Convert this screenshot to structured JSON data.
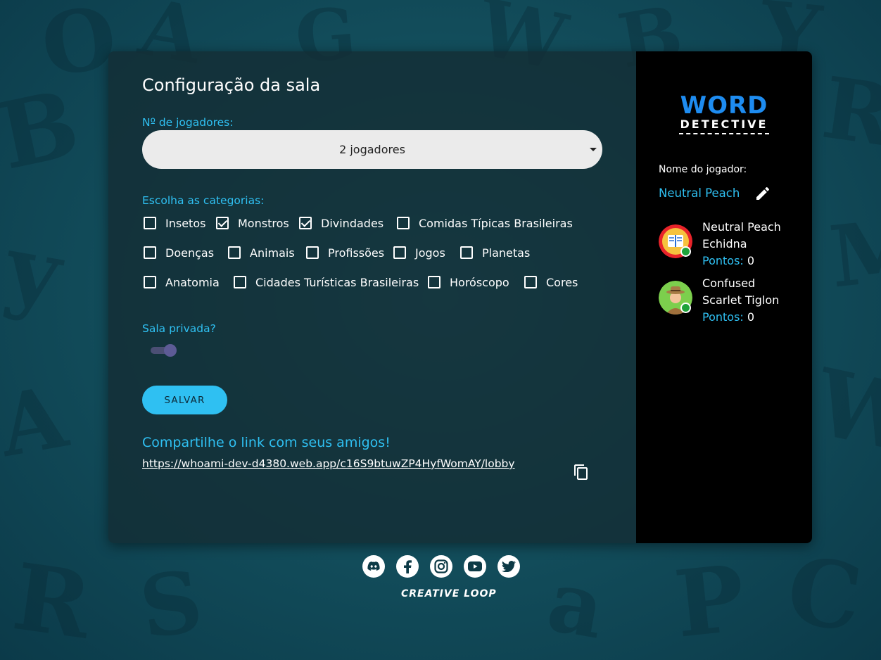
{
  "room": {
    "title": "Configuração da sala",
    "players_label": "Nº de jogadores:",
    "players_selected": "2 jogadores",
    "categories_label": "Escolha as categorias:",
    "categories": [
      {
        "label": "Insetos",
        "checked": false
      },
      {
        "label": "Monstros",
        "checked": true
      },
      {
        "label": "Divindades",
        "checked": true
      },
      {
        "label": "Comidas Típicas Brasileiras",
        "checked": false
      },
      {
        "label": "Doenças",
        "checked": false
      },
      {
        "label": "Animais",
        "checked": false
      },
      {
        "label": "Profissões",
        "checked": false
      },
      {
        "label": "Jogos",
        "checked": false
      },
      {
        "label": "Planetas",
        "checked": false
      },
      {
        "label": "Anatomia",
        "checked": false
      },
      {
        "label": "Cidades Turísticas Brasileiras",
        "checked": false
      },
      {
        "label": "Horóscopo",
        "checked": false
      },
      {
        "label": "Cores",
        "checked": false
      }
    ],
    "private_label": "Sala privada?",
    "private_on": true,
    "save_label": "SALVAR",
    "share_label": "Compartilhe o link com seus amigos!",
    "share_link": "https://whoami-dev-d4380.web.app/c16S9btuwZP4HyfWomAY/lobby"
  },
  "sidebar": {
    "logo_top": "WORD",
    "logo_bottom": "DETECTIVE",
    "player_name_label": "Nome do jogador:",
    "player_name": "Neutral Peach",
    "players": [
      {
        "name_line1": "Neutral Peach",
        "name_line2": "Echidna",
        "points_label": "Pontos:",
        "points": "0",
        "avatar": "book-avatar-icon",
        "online": true
      },
      {
        "name_line1": "Confused",
        "name_line2": "Scarlet Tiglon",
        "points_label": "Pontos:",
        "points": "0",
        "avatar": "detective-avatar-icon",
        "online": true
      }
    ]
  },
  "footer": {
    "socials": [
      "discord-icon",
      "facebook-icon",
      "instagram-icon",
      "youtube-icon",
      "twitter-icon"
    ],
    "brand": "CREATIVE LOOP"
  },
  "colors": {
    "accent": "#2fc0f2",
    "logo_blue": "#1e8cf0",
    "online": "#1ea33a"
  }
}
